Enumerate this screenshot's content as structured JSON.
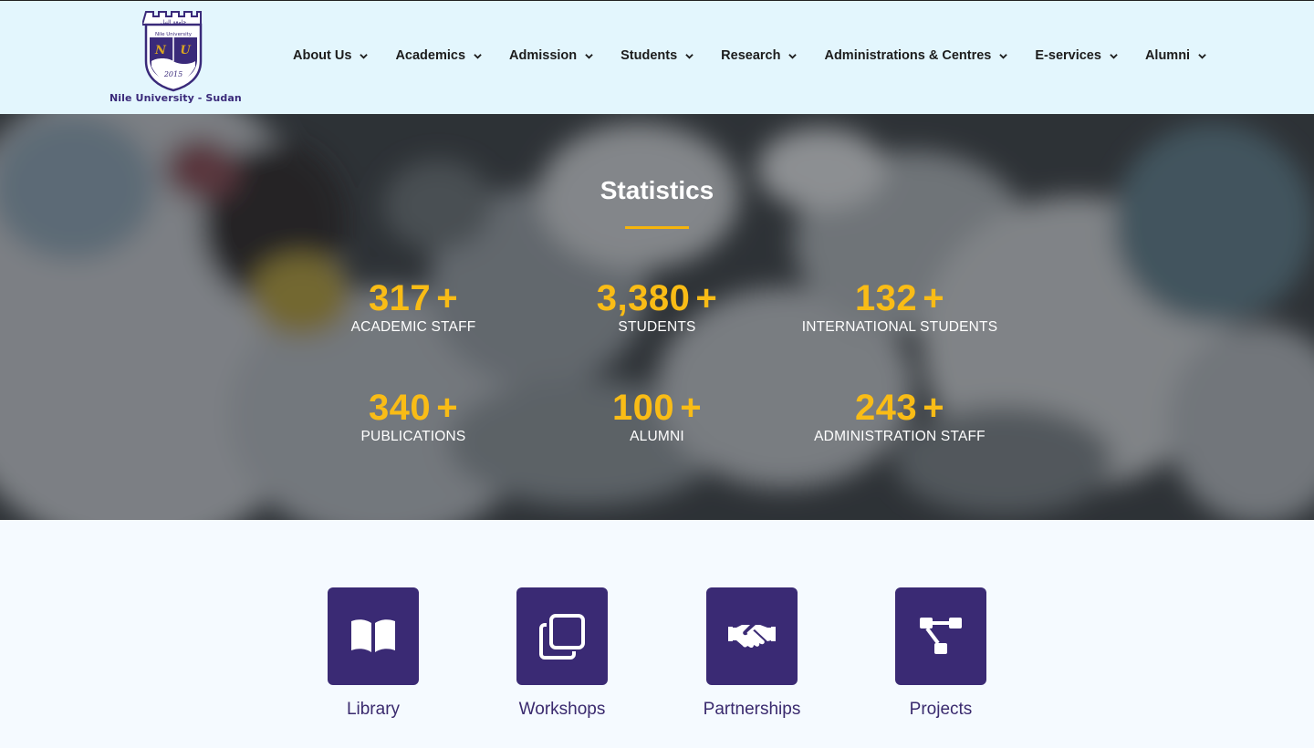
{
  "brand": {
    "name": "Nile University - Sudan",
    "crest_top": "جامعة النيل",
    "crest_sub": "Nile University",
    "crest_letters": [
      "N",
      "U"
    ],
    "crest_year": "2015",
    "colors": {
      "navy": "#3a2a7a",
      "gold": "#d9a521"
    }
  },
  "nav": {
    "items": [
      {
        "label": "About Us",
        "icon": "chevron-down-icon"
      },
      {
        "label": "Academics",
        "icon": "chevron-down-icon"
      },
      {
        "label": "Admission",
        "icon": "chevron-down-icon"
      },
      {
        "label": "Students",
        "icon": "chevron-down-icon"
      },
      {
        "label": "Research",
        "icon": "chevron-down-icon"
      },
      {
        "label": "Administrations & Centres",
        "icon": "chevron-down-icon"
      },
      {
        "label": "E-services",
        "icon": "chevron-down-icon"
      },
      {
        "label": "Alumni",
        "icon": "chevron-down-icon"
      }
    ]
  },
  "statistics": {
    "title": "Statistics",
    "accent": "#f9bc16",
    "items": [
      {
        "value": "317",
        "suffix": "+",
        "label": "ACADEMIC STAFF"
      },
      {
        "value": "3,380",
        "suffix": "+",
        "label": "STUDENTS"
      },
      {
        "value": "132",
        "suffix": "+",
        "label": "INTERNATIONAL STUDENTS"
      },
      {
        "value": "340",
        "suffix": "+",
        "label": "PUBLICATIONS"
      },
      {
        "value": "100",
        "suffix": "+",
        "label": "ALUMNI"
      },
      {
        "value": "243",
        "suffix": "+",
        "label": "ADMINISTRATION STAFF"
      }
    ]
  },
  "services": {
    "box_color": "#3a2a74",
    "items": [
      {
        "label": "Library",
        "icon": "open-book-icon"
      },
      {
        "label": "Workshops",
        "icon": "clone-icon"
      },
      {
        "label": "Partnerships",
        "icon": "handshake-icon"
      },
      {
        "label": "Projects",
        "icon": "project-diagram-icon"
      }
    ]
  }
}
